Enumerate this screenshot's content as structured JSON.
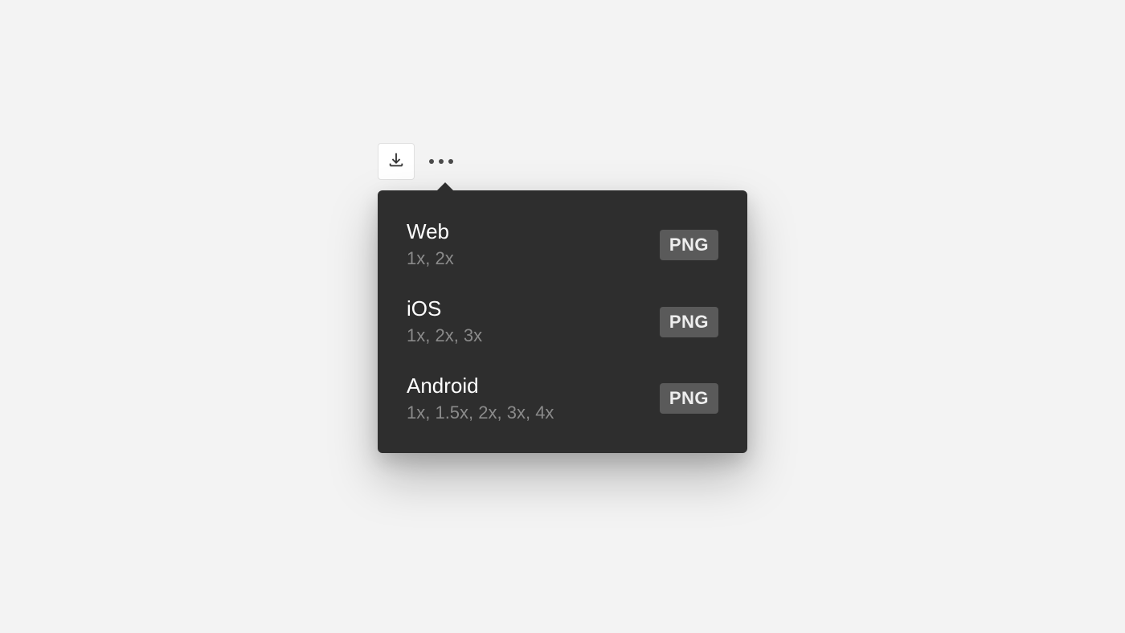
{
  "export_presets": [
    {
      "title": "Web",
      "subtitle": "1x, 2x",
      "format": "PNG"
    },
    {
      "title": "iOS",
      "subtitle": "1x, 2x, 3x",
      "format": "PNG"
    },
    {
      "title": "Android",
      "subtitle": "1x, 1.5x, 2x, 3x, 4x",
      "format": "PNG"
    }
  ]
}
